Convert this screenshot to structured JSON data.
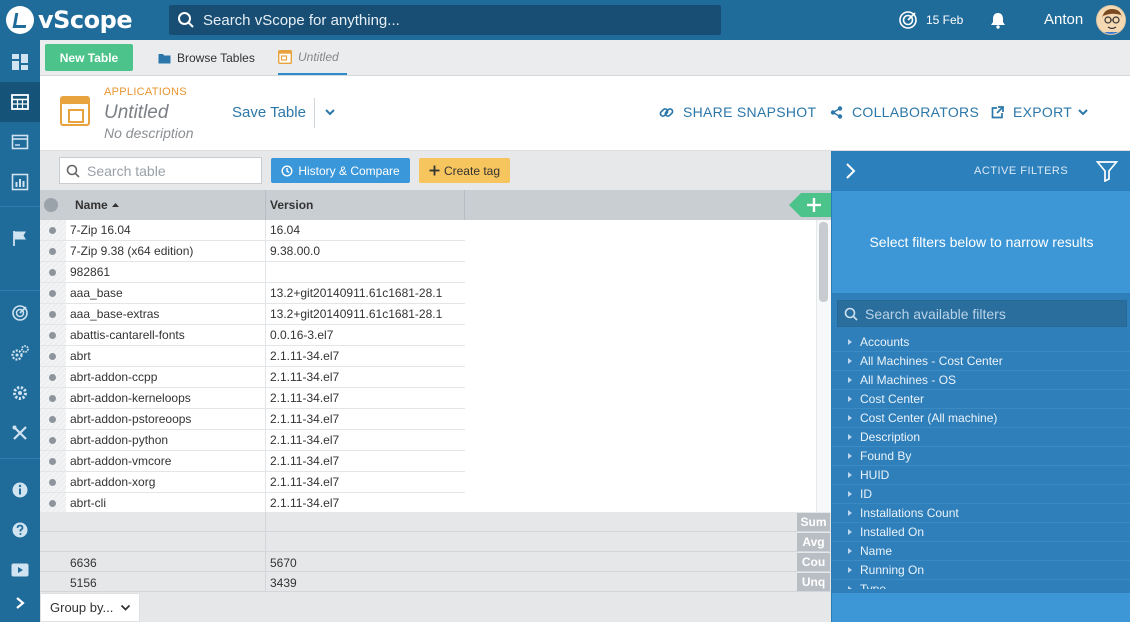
{
  "topbar": {
    "logo": "vScope",
    "search_placeholder": "Search vScope for anything...",
    "date": "15 Feb",
    "user": "Anton"
  },
  "tabs": {
    "new_table": "New Table",
    "browse": "Browse Tables",
    "untitled": "Untitled"
  },
  "header": {
    "category": "APPLICATIONS",
    "title": "Untitled",
    "description": "No description",
    "save": "Save Table",
    "share": "SHARE SNAPSHOT",
    "collaborators": "COLLABORATORS",
    "export": "EXPORT"
  },
  "toolbar": {
    "search_placeholder": "Search table",
    "history": "History & Compare",
    "create_tag": "Create tag"
  },
  "table": {
    "columns": [
      "Name",
      "Version"
    ],
    "rows": [
      {
        "name": "7-Zip 16.04",
        "version": "16.04"
      },
      {
        "name": "7-Zip 9.38 (x64 edition)",
        "version": "9.38.00.0"
      },
      {
        "name": "982861",
        "version": ""
      },
      {
        "name": "aaa_base",
        "version": "13.2+git20140911.61c1681-28.1"
      },
      {
        "name": "aaa_base-extras",
        "version": "13.2+git20140911.61c1681-28.1"
      },
      {
        "name": "abattis-cantarell-fonts",
        "version": "0.0.16-3.el7"
      },
      {
        "name": "abrt",
        "version": "2.1.11-34.el7"
      },
      {
        "name": "abrt-addon-ccpp",
        "version": "2.1.11-34.el7"
      },
      {
        "name": "abrt-addon-kerneloops",
        "version": "2.1.11-34.el7"
      },
      {
        "name": "abrt-addon-pstoreoops",
        "version": "2.1.11-34.el7"
      },
      {
        "name": "abrt-addon-python",
        "version": "2.1.11-34.el7"
      },
      {
        "name": "abrt-addon-vmcore",
        "version": "2.1.11-34.el7"
      },
      {
        "name": "abrt-addon-xorg",
        "version": "2.1.11-34.el7"
      },
      {
        "name": "abrt-cli",
        "version": "2.1.11-34.el7"
      }
    ]
  },
  "summary": {
    "sum_label": "Sum",
    "avg_label": "Avg",
    "count_label": "Cou",
    "unique_label": "Unq",
    "count_name": "6636",
    "count_version": "5670",
    "unique_name": "5156",
    "unique_version": "3439"
  },
  "group_by": "Group by...",
  "filters": {
    "title": "ACTIVE FILTERS",
    "message": "Select filters below to narrow results",
    "search_placeholder": "Search available filters",
    "items": [
      "Accounts",
      "All Machines - Cost Center",
      "All Machines - OS",
      "Cost Center",
      "Cost Center (All machine)",
      "Description",
      "Found By",
      "HUID",
      "ID",
      "Installations Count",
      "Installed On",
      "Name",
      "Running On",
      "Type"
    ]
  }
}
